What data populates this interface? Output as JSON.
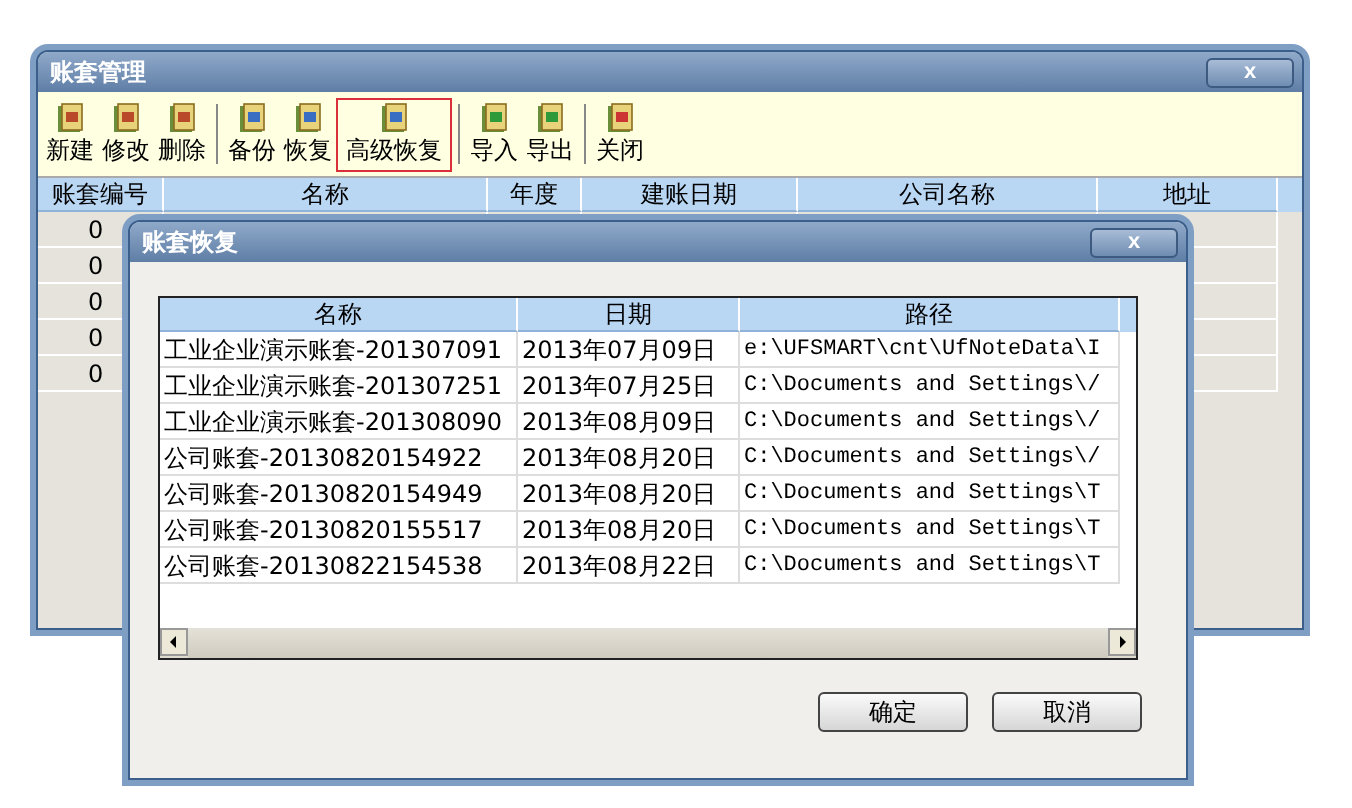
{
  "main_window": {
    "title": "账套管理",
    "close": "x",
    "toolbar": [
      [
        {
          "label": "新建",
          "highlighted": false
        },
        {
          "label": "修改",
          "highlighted": false
        },
        {
          "label": "删除",
          "highlighted": false
        }
      ],
      [
        {
          "label": "备份",
          "highlighted": false
        },
        {
          "label": "恢复",
          "highlighted": false
        },
        {
          "label": "高级恢复",
          "highlighted": true
        }
      ],
      [
        {
          "label": "导入",
          "highlighted": false
        },
        {
          "label": "导出",
          "highlighted": false
        }
      ],
      [
        {
          "label": "关闭",
          "highlighted": false
        }
      ]
    ],
    "table": {
      "columns": [
        "账套编号",
        "名称",
        "年度",
        "建账日期",
        "公司名称",
        "地址"
      ],
      "rows": [
        [
          "0"
        ],
        [
          "0"
        ],
        [
          "0"
        ],
        [
          "0"
        ],
        [
          "0"
        ]
      ]
    }
  },
  "dialog": {
    "title": "账套恢复",
    "close": "x",
    "table": {
      "columns": [
        "名称",
        "日期",
        "路径"
      ],
      "rows": [
        [
          "工业企业演示账套-201307091",
          "2013年07月09日",
          "e:\\UFSMART\\cnt\\UfNoteData\\I"
        ],
        [
          "工业企业演示账套-201307251",
          "2013年07月25日",
          "C:\\Documents and Settings\\/"
        ],
        [
          "工业企业演示账套-201308090",
          "2013年08月09日",
          "C:\\Documents and Settings\\/"
        ],
        [
          "公司账套-20130820154922",
          "2013年08月20日",
          "C:\\Documents and Settings\\/"
        ],
        [
          "公司账套-20130820154949",
          "2013年08月20日",
          "C:\\Documents and Settings\\T"
        ],
        [
          "公司账套-20130820155517",
          "2013年08月20日",
          "C:\\Documents and Settings\\T"
        ],
        [
          "公司账套-20130822154538",
          "2013年08月22日",
          "C:\\Documents and Settings\\T"
        ]
      ]
    },
    "buttons": [
      "确定",
      "取消"
    ]
  }
}
